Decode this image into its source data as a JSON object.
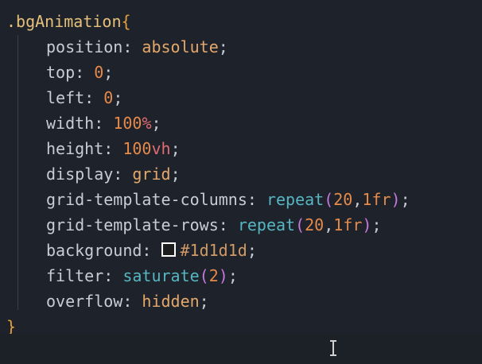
{
  "code": {
    "selector": ".bgAnimation",
    "open_brace": "{",
    "close_brace": "}",
    "colon": ": ",
    "semicolon": ";",
    "comma": ",",
    "paren_open": "(",
    "paren_close": ")",
    "lines": {
      "position": {
        "prop": "position",
        "value": "absolute"
      },
      "top": {
        "prop": "top",
        "value": "0"
      },
      "left": {
        "prop": "left",
        "value": "0"
      },
      "width": {
        "prop": "width",
        "num": "100",
        "unit": "%"
      },
      "height": {
        "prop": "height",
        "num": "100",
        "unit": "vh"
      },
      "display": {
        "prop": "display",
        "value": "grid"
      },
      "grid_columns": {
        "prop": "grid-template-columns",
        "fn": "repeat",
        "arg1": "20",
        "arg2": "1fr"
      },
      "grid_rows": {
        "prop": "grid-template-rows",
        "fn": "repeat",
        "arg1": "20",
        "arg2": "1fr"
      },
      "background": {
        "prop": "background",
        "value": "#1d1d1d"
      },
      "filter": {
        "prop": "filter",
        "fn": "saturate",
        "arg1": "2"
      },
      "overflow": {
        "prop": "overflow",
        "value": "hidden"
      }
    }
  },
  "colors": {
    "editor_bg": "#1e222a",
    "swatch_color": "#1d1d1d"
  },
  "icons": {
    "color_swatch": "color-swatch-icon",
    "cursor": "text-cursor-icon"
  }
}
